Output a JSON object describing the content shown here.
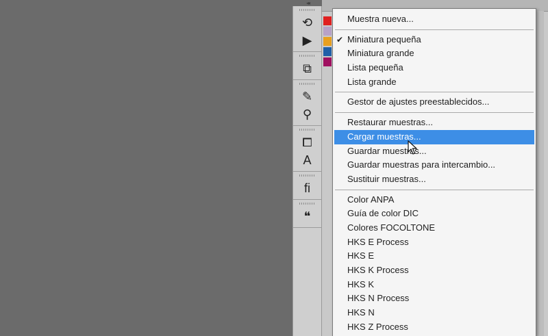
{
  "menu": {
    "items": [
      {
        "label": "Muestra nueva...",
        "checked": false,
        "highlighted": false
      },
      {
        "separator": true
      },
      {
        "label": "Miniatura pequeña",
        "checked": true,
        "highlighted": false
      },
      {
        "label": "Miniatura grande",
        "checked": false,
        "highlighted": false
      },
      {
        "label": "Lista pequeña",
        "checked": false,
        "highlighted": false
      },
      {
        "label": "Lista grande",
        "checked": false,
        "highlighted": false
      },
      {
        "separator": true
      },
      {
        "label": "Gestor de ajustes preestablecidos...",
        "checked": false,
        "highlighted": false
      },
      {
        "separator": true
      },
      {
        "label": "Restaurar muestras...",
        "checked": false,
        "highlighted": false
      },
      {
        "label": "Cargar muestras...",
        "checked": false,
        "highlighted": true
      },
      {
        "label": "Guardar muestras...",
        "checked": false,
        "highlighted": false
      },
      {
        "label": "Guardar muestras para intercambio...",
        "checked": false,
        "highlighted": false
      },
      {
        "label": "Sustituir muestras...",
        "checked": false,
        "highlighted": false
      },
      {
        "separator": true
      },
      {
        "label": "Color ANPA",
        "checked": false,
        "highlighted": false
      },
      {
        "label": "Guía de color DIC",
        "checked": false,
        "highlighted": false
      },
      {
        "label": "Colores FOCOLTONE",
        "checked": false,
        "highlighted": false
      },
      {
        "label": "HKS E Process",
        "checked": false,
        "highlighted": false
      },
      {
        "label": "HKS E",
        "checked": false,
        "highlighted": false
      },
      {
        "label": "HKS K Process",
        "checked": false,
        "highlighted": false
      },
      {
        "label": "HKS K",
        "checked": false,
        "highlighted": false
      },
      {
        "label": "HKS N Process",
        "checked": false,
        "highlighted": false
      },
      {
        "label": "HKS N",
        "checked": false,
        "highlighted": false
      },
      {
        "label": "HKS Z Process",
        "checked": false,
        "highlighted": false
      }
    ],
    "check_glyph": "✔",
    "highlight_color": "#3d8ee6"
  },
  "toolbar": {
    "groups": [
      {
        "tools": [
          {
            "icon": "history-icon",
            "glyph": "⟲"
          },
          {
            "icon": "actions-play-icon",
            "glyph": "▶"
          }
        ]
      },
      {
        "tools": [
          {
            "icon": "layer-comps-icon",
            "glyph": "⧉"
          }
        ]
      },
      {
        "tools": [
          {
            "icon": "brushes-icon",
            "glyph": "✎"
          },
          {
            "icon": "brush-presets-icon",
            "glyph": "⚲"
          }
        ]
      },
      {
        "tools": [
          {
            "icon": "clone-source-icon",
            "glyph": "⧠"
          },
          {
            "icon": "character-styles-icon",
            "glyph": "A"
          }
        ]
      },
      {
        "tools": [
          {
            "icon": "glyphs-icon",
            "glyph": "fi"
          }
        ]
      },
      {
        "tools": [
          {
            "icon": "notes-icon",
            "glyph": "❝"
          }
        ]
      }
    ],
    "collapse_glyph": "◂◂"
  },
  "swatch_colors": [
    "#e02020",
    "#b8a2c8",
    "#e8a020",
    "#2060a8",
    "#a01060"
  ]
}
